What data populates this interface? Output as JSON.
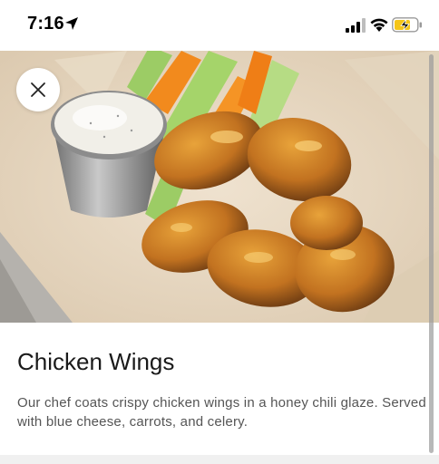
{
  "status_bar": {
    "time": "7:16",
    "icons": [
      "location-arrow-icon",
      "cellular-signal-icon",
      "wifi-icon",
      "battery-charging-icon"
    ],
    "battery_color": "#f5c518"
  },
  "hero": {
    "image_description_icon": "chicken-wings-photo"
  },
  "close_button": {
    "icon": "close-icon"
  },
  "item": {
    "title": "Chicken Wings",
    "description": "Our chef coats crispy chicken wings in a honey chili glaze. Served with blue cheese, carrots, and celery."
  }
}
